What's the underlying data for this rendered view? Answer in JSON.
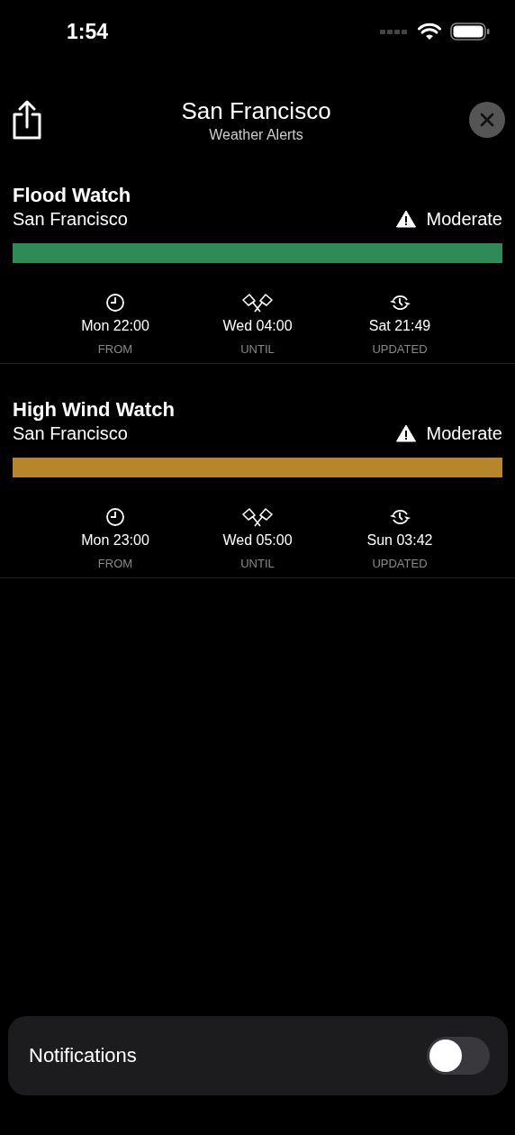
{
  "status_bar": {
    "time": "1:54"
  },
  "header": {
    "title": "San Francisco",
    "subtitle": "Weather Alerts"
  },
  "alerts": [
    {
      "title": "Flood Watch",
      "area": "San Francisco",
      "severity": "Moderate",
      "color": "#2e8b57",
      "times": [
        {
          "kind": "from",
          "value": "Mon 22:00",
          "label": "FROM"
        },
        {
          "kind": "until",
          "value": "Wed 04:00",
          "label": "UNTIL"
        },
        {
          "kind": "updated",
          "value": "Sat 21:49",
          "label": "UPDATED"
        }
      ]
    },
    {
      "title": "High Wind Watch",
      "area": "San Francisco",
      "severity": "Moderate",
      "color": "#b8862a",
      "times": [
        {
          "kind": "from",
          "value": "Mon 23:00",
          "label": "FROM"
        },
        {
          "kind": "until",
          "value": "Wed 05:00",
          "label": "UNTIL"
        },
        {
          "kind": "updated",
          "value": "Sun 03:42",
          "label": "UPDATED"
        }
      ]
    }
  ],
  "notifications": {
    "label": "Notifications",
    "on": false
  }
}
